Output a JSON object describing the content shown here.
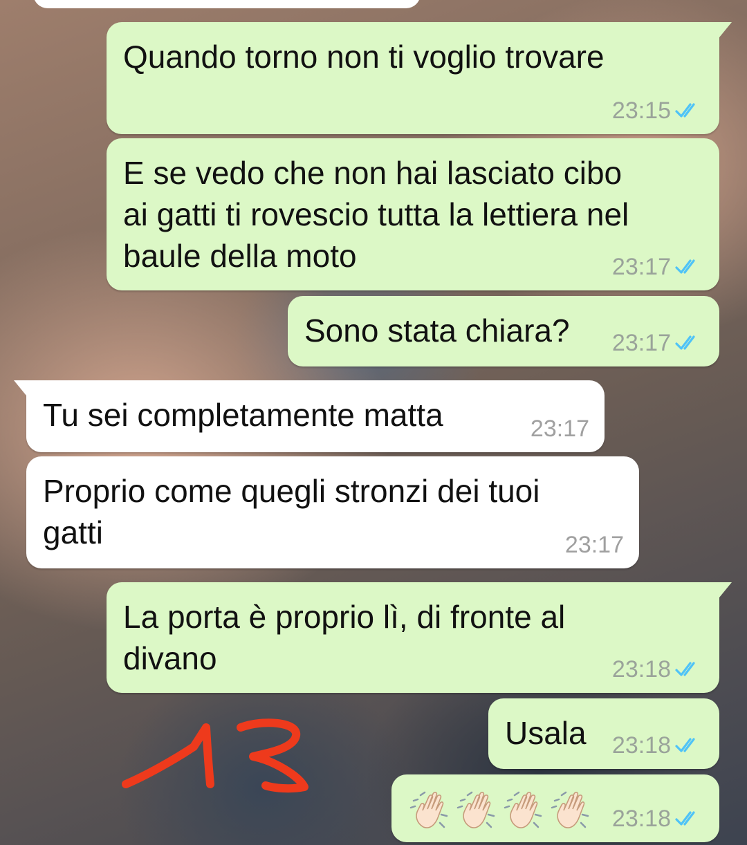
{
  "messages": [
    {
      "side": "out",
      "text": "Quando torno non ti voglio trovare",
      "time": "23:15",
      "status_icon": "double-check-read-icon"
    },
    {
      "side": "out",
      "text": "E se vedo che non hai lasciato cibo\nai gatti ti rovescio tutta la lettiera nel\nbaule della moto",
      "time": "23:17",
      "status_icon": "double-check-read-icon"
    },
    {
      "side": "out",
      "text": "Sono stata chiara?",
      "time": "23:17",
      "status_icon": "double-check-read-icon"
    },
    {
      "side": "in",
      "text": "Tu sei completamente matta",
      "time": "23:17"
    },
    {
      "side": "in",
      "text": "Proprio come quegli stronzi dei tuoi\ngatti",
      "time": "23:17"
    },
    {
      "side": "out",
      "text": "La porta è proprio lì, di fronte al\ndivano",
      "time": "23:18",
      "status_icon": "double-check-read-icon"
    },
    {
      "side": "out",
      "text": "Usala",
      "time": "23:18",
      "status_icon": "double-check-read-icon"
    },
    {
      "side": "out",
      "emoji": [
        "waving-hand-icon",
        "waving-hand-icon",
        "waving-hand-icon",
        "waving-hand-icon"
      ],
      "time": "23:18",
      "status_icon": "double-check-read-icon"
    }
  ],
  "colors": {
    "outgoing_bubble": "#dcf8c6",
    "incoming_bubble": "#ffffff",
    "read_ticks": "#4fc3f7",
    "annotation": "#ee3a1c"
  }
}
